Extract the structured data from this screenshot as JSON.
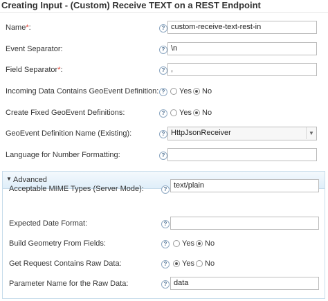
{
  "page": {
    "title": "Creating Input - (Custom) Receive TEXT on a REST Endpoint"
  },
  "help_glyph": "?",
  "fields": {
    "name": {
      "label": "Name",
      "required_mark": "*",
      "suffix": ":",
      "value": "custom-receive-text-rest-in"
    },
    "event_separator": {
      "label": "Event Separator:",
      "value": "\\n"
    },
    "field_separator": {
      "label": "Field Separator",
      "required_mark": "*",
      "suffix": ":",
      "value": ","
    },
    "incoming_geoevent": {
      "label": "Incoming Data Contains GeoEvent Definition:",
      "options": [
        "Yes",
        "No"
      ],
      "selected": "No"
    },
    "create_fixed": {
      "label": "Create Fixed GeoEvent Definitions:",
      "options": [
        "Yes",
        "No"
      ],
      "selected": "No"
    },
    "geoevent_def_name": {
      "label": "GeoEvent Definition Name (Existing):",
      "value": "HttpJsonReceiver"
    },
    "language": {
      "label": "Language for Number Formatting:",
      "value": ""
    }
  },
  "advanced": {
    "header": "Advanced",
    "fields": {
      "mime_types": {
        "label": "Acceptable MIME Types (Server Mode):",
        "value": "text/plain"
      },
      "date_format": {
        "label": "Expected Date Format:",
        "value": ""
      },
      "build_geometry": {
        "label": "Build Geometry From Fields:",
        "options": [
          "Yes",
          "No"
        ],
        "selected": "No"
      },
      "raw_data": {
        "label": "Get Request Contains Raw Data:",
        "options": [
          "Yes",
          "No"
        ],
        "selected": "Yes"
      },
      "raw_param": {
        "label": "Parameter Name for the Raw Data:",
        "value": "data"
      }
    }
  }
}
